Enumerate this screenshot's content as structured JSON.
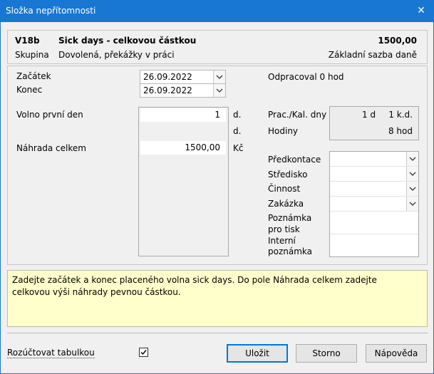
{
  "window": {
    "title": "Složka nepřítomnosti",
    "close_glyph": "✕"
  },
  "header": {
    "code": "V18b",
    "name": "Sick days - celkovou částkou",
    "amount": "1500,00",
    "group_label": "Skupina",
    "group_value": "Dovolená, překážky v práci",
    "rate_label": "Základní sazba daně"
  },
  "dates": {
    "start_label": "Začátek",
    "start_value": "26.09.2022",
    "end_label": "Konec",
    "end_value": "26.09.2022",
    "worked_label": "Odpracoval 0 hod"
  },
  "fields": {
    "free_first_day_label": "Volno první den",
    "free_first_day_value": "1",
    "unit_d1": "d.",
    "unit_d2": "d.",
    "total_comp_label": "Náhrada celkem",
    "total_comp_value": "1500,00",
    "currency": "Kč"
  },
  "stats": {
    "work_cal_days_label": "Prac./Kal. dny",
    "work_days": "1 d",
    "cal_days": "1 k.d.",
    "hours_label": "Hodiny",
    "hours_value": "8 hod"
  },
  "accounting": {
    "predkontace": "Předkontace",
    "stredisko": "Středisko",
    "cinnost": "Činnost",
    "zakazka": "Zakázka",
    "note_print_1": "Poznámka",
    "note_print_2": "pro tisk",
    "note_internal_1": "Interní",
    "note_internal_2": "poznámka"
  },
  "hint_text": "Zadejte začátek a konec placeného volna sick days. Do pole Náhrada celkem zadejte celkovou výši náhrady pevnou částkou.",
  "footer": {
    "checkbox_label": "Rozúčtovat tabulkou",
    "checkbox_checked": true,
    "ok_label": "Uložit",
    "cancel_label": "Storno",
    "help_label": "Nápověda"
  },
  "icons": {
    "chevron": "chevron-down-icon",
    "check": "check-icon"
  }
}
